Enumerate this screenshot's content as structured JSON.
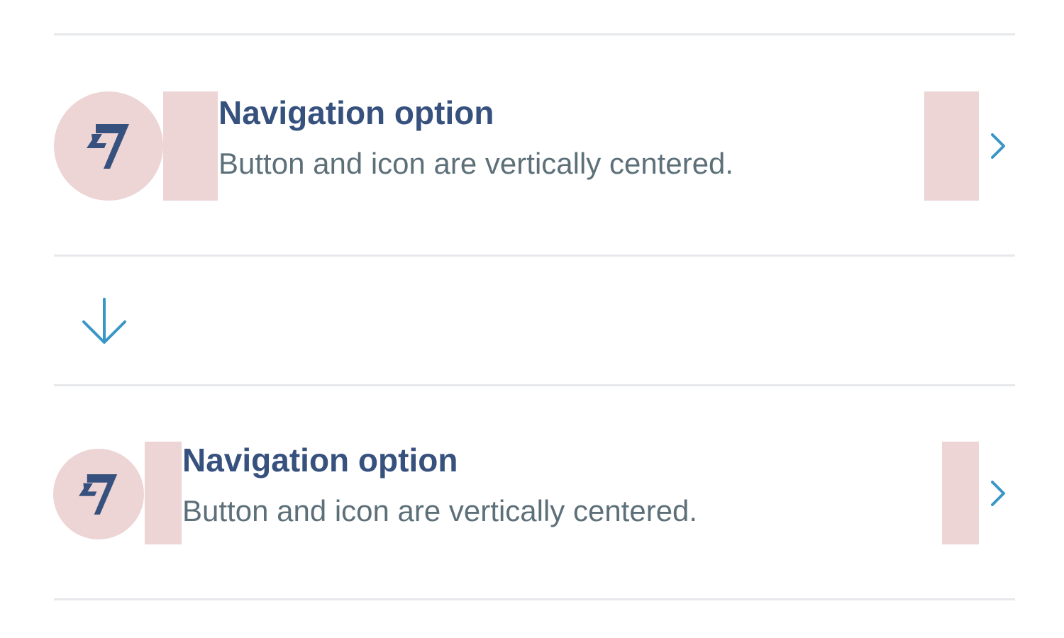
{
  "colors": {
    "title": "#37517e",
    "body": "#5d7079",
    "accent": "#3996c6",
    "placeholder_pink": "#edd4d5",
    "divider": "#e6e8eb"
  },
  "rows": [
    {
      "title": "Navigation option",
      "body": "Button and icon are vertically centered.",
      "avatar_icon": "wise-logo-icon",
      "action_icon": "chevron-right-icon"
    },
    {
      "title": "Navigation option",
      "body": "Button and icon are vertically centered.",
      "avatar_icon": "wise-logo-icon",
      "action_icon": "chevron-right-icon"
    }
  ],
  "separator_icon": "arrow-down-icon"
}
